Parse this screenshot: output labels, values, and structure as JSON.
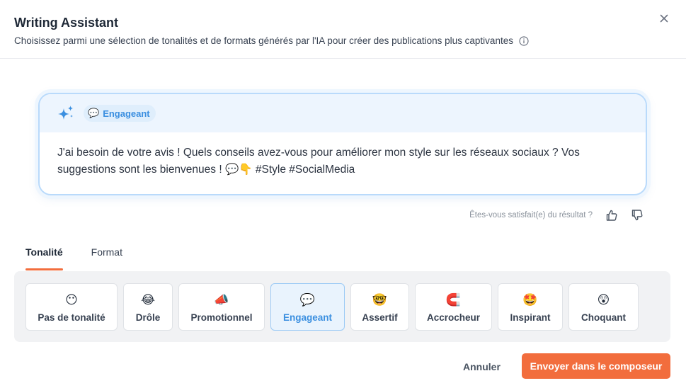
{
  "dialog": {
    "title": "Writing Assistant",
    "subtitle": "Choisissez parmi une sélection de tonalités et de formats générés par l'IA pour créer des publications plus captivantes"
  },
  "result": {
    "tone_emoji": "💬",
    "tone_label": "Engageant",
    "text": "J'ai besoin de votre avis ! Quels conseils avez-vous pour améliorer mon style sur les réseaux sociaux ? Vos suggestions sont les bienvenues ! 💬👇 #Style #SocialMedia"
  },
  "feedback": {
    "question": "Êtes-vous satisfait(e) du résultat ?"
  },
  "tabs": [
    {
      "label": "Tonalité",
      "active": true
    },
    {
      "label": "Format",
      "active": false
    }
  ],
  "tones": [
    {
      "emoji": "😶",
      "label": "Pas de tonalité"
    },
    {
      "emoji": "😂",
      "label": "Drôle"
    },
    {
      "emoji": "📣",
      "label": "Promotionnel"
    },
    {
      "emoji": "💬",
      "label": "Engageant",
      "selected": true
    },
    {
      "emoji": "🤓",
      "label": "Assertif"
    },
    {
      "emoji": "🧲",
      "label": "Accrocheur"
    },
    {
      "emoji": "🤩",
      "label": "Inspirant"
    },
    {
      "emoji": "😲",
      "label": "Choquant"
    }
  ],
  "footer": {
    "cancel_label": "Annuler",
    "send_label": "Envoyer dans le composeur"
  },
  "colors": {
    "accent": "#f26d3d",
    "selection_blue": "#3b8fe0"
  },
  "icons": [
    "info-icon",
    "close-icon",
    "sparkle-icon",
    "thumbs-up-icon",
    "thumbs-down-icon"
  ]
}
